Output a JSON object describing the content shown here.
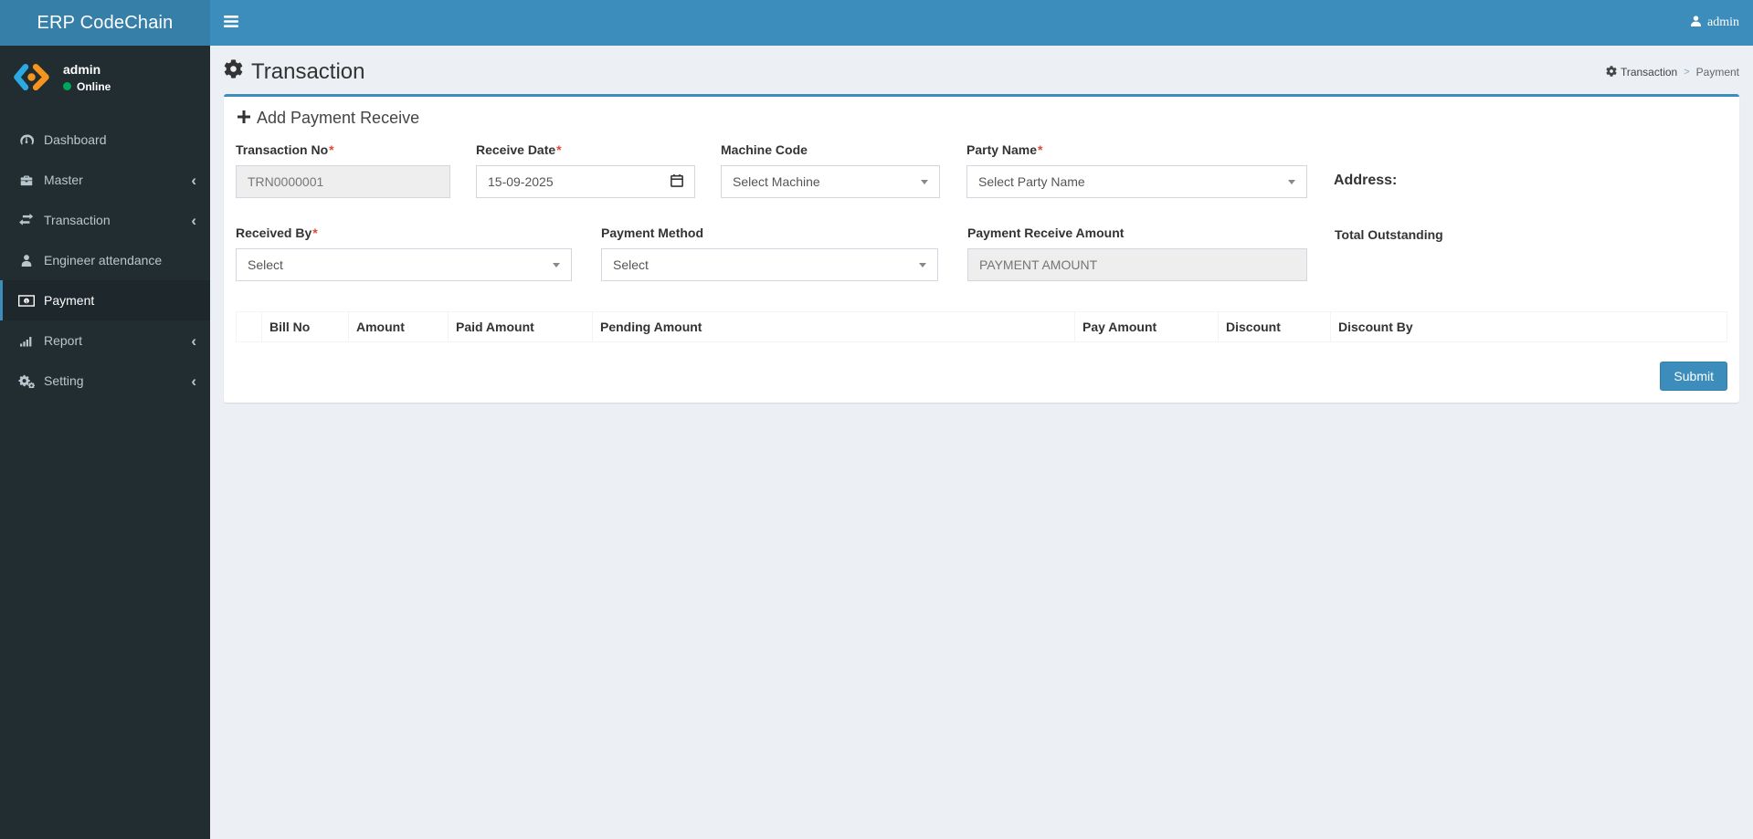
{
  "navbar": {
    "brand": "ERP CodeChain",
    "user_label": "admin"
  },
  "sidebar": {
    "user": {
      "name": "admin",
      "status": "Online"
    },
    "items": [
      {
        "label": "Dashboard",
        "icon": "dashboard-icon",
        "has_arrow": false,
        "active": false
      },
      {
        "label": "Master",
        "icon": "briefcase-icon",
        "has_arrow": true,
        "active": false
      },
      {
        "label": "Transaction",
        "icon": "exchange-icon",
        "has_arrow": true,
        "active": false
      },
      {
        "label": "Engineer attendance",
        "icon": "user-icon",
        "has_arrow": false,
        "active": false
      },
      {
        "label": "Payment",
        "icon": "money-icon",
        "has_arrow": false,
        "active": true
      },
      {
        "label": "Report",
        "icon": "bar-chart-icon",
        "has_arrow": true,
        "active": false
      },
      {
        "label": "Setting",
        "icon": "gears-icon",
        "has_arrow": true,
        "active": false
      }
    ]
  },
  "page": {
    "title": "Transaction",
    "breadcrumb": {
      "items": [
        "Transaction",
        "Payment"
      ]
    }
  },
  "form": {
    "title": "Add Payment Receive",
    "required_mark": "*",
    "transaction_no": {
      "label": "Transaction No",
      "value": "TRN0000001"
    },
    "receive_date": {
      "label": "Receive Date",
      "value": "15-09-2025"
    },
    "machine_code": {
      "label": "Machine Code",
      "value": "Select Machine"
    },
    "party_name": {
      "label": "Party Name",
      "value": "Select Party Name"
    },
    "address": {
      "label": "Address:"
    },
    "received_by": {
      "label": "Received By",
      "value": "Select"
    },
    "payment_method": {
      "label": "Payment Method",
      "value": "Select"
    },
    "payment_receive_amount": {
      "label": "Payment Receive Amount",
      "placeholder": "PAYMENT AMOUNT"
    },
    "total_outstanding": {
      "label": "Total Outstanding"
    },
    "submit_label": "Submit"
  },
  "table": {
    "headers": [
      "",
      "Bill No",
      "Amount",
      "Paid Amount",
      "Pending Amount",
      "Pay Amount",
      "Discount",
      "Discount By"
    ]
  },
  "colors": {
    "accent": "#3c8dbc",
    "logo_bg": "#367fa9",
    "sidebar_bg": "#222d32",
    "sidebar_text": "#b8c7ce",
    "active_item_bg": "#1e282c",
    "content_bg": "#ecf0f5",
    "status_online": "#00a65a",
    "required": "#dd4b39",
    "disabled_bg": "#eeeeee"
  }
}
